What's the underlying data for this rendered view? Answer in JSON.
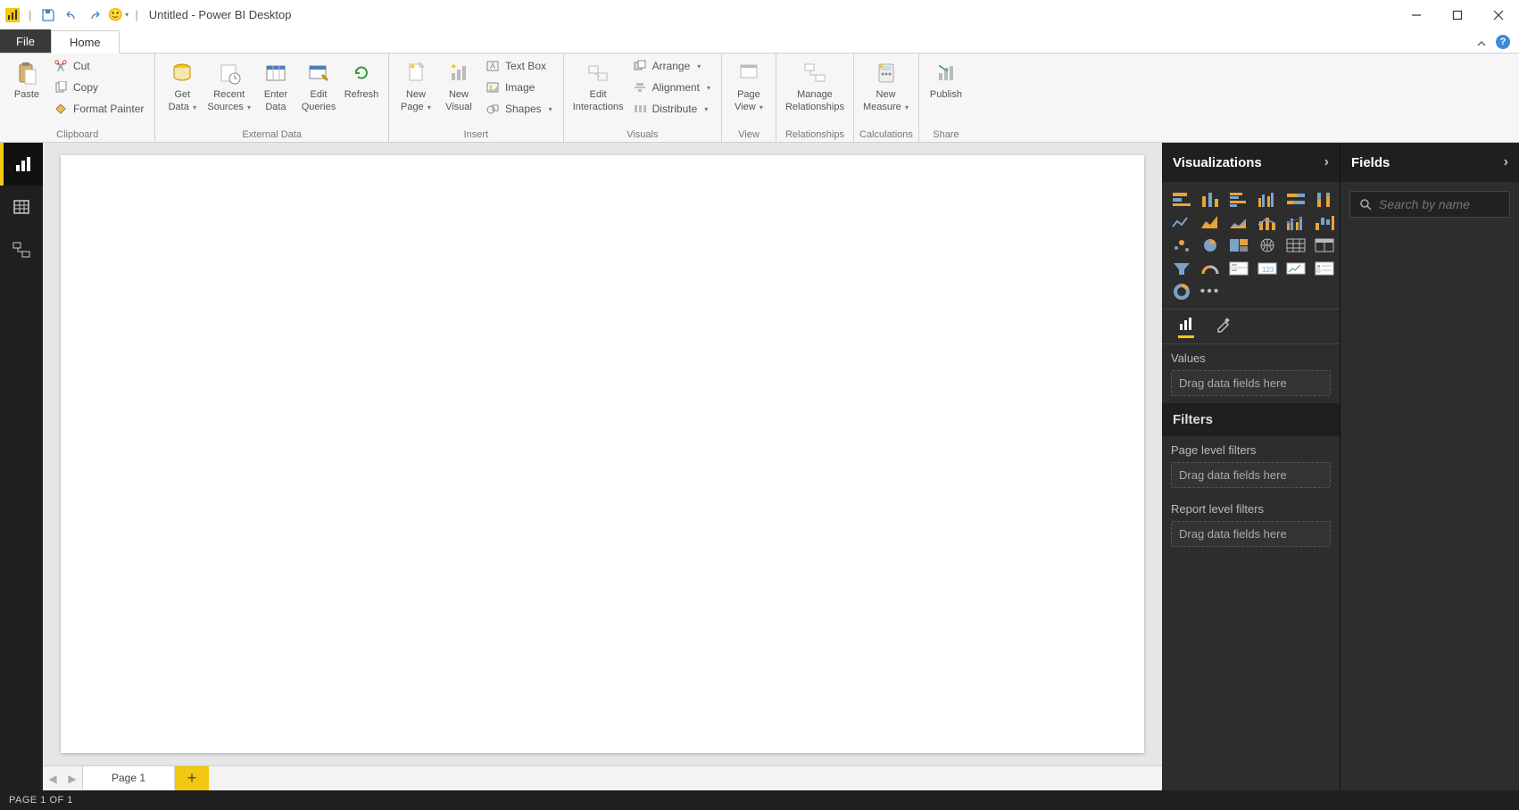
{
  "titlebar": {
    "title": "Untitled - Power BI Desktop"
  },
  "tabs": {
    "file": "File",
    "home": "Home"
  },
  "ribbon": {
    "clipboard": {
      "label": "Clipboard",
      "paste": "Paste",
      "cut": "Cut",
      "copy": "Copy",
      "format_painter": "Format Painter"
    },
    "external_data": {
      "label": "External Data",
      "get_data": "Get\nData",
      "recent_sources": "Recent\nSources",
      "enter_data": "Enter\nData",
      "edit_queries": "Edit\nQueries",
      "refresh": "Refresh"
    },
    "insert": {
      "label": "Insert",
      "new_page": "New\nPage",
      "new_visual": "New\nVisual",
      "text_box": "Text Box",
      "image": "Image",
      "shapes": "Shapes"
    },
    "visuals": {
      "label": "Visuals",
      "edit_interactions": "Edit\nInteractions",
      "arrange": "Arrange",
      "alignment": "Alignment",
      "distribute": "Distribute"
    },
    "view": {
      "label": "View",
      "page_view": "Page\nView"
    },
    "relationships": {
      "label": "Relationships",
      "manage": "Manage\nRelationships"
    },
    "calculations": {
      "label": "Calculations",
      "new_measure": "New\nMeasure"
    },
    "share": {
      "label": "Share",
      "publish": "Publish"
    }
  },
  "pages": {
    "page1": "Page 1"
  },
  "viz": {
    "header": "Visualizations",
    "values_label": "Values",
    "drop_hint": "Drag data fields here"
  },
  "filters": {
    "header": "Filters",
    "page_level": "Page level filters",
    "report_level": "Report level filters",
    "drop_hint": "Drag data fields here"
  },
  "fields": {
    "header": "Fields",
    "search_placeholder": "Search by name"
  },
  "status": "PAGE 1 OF 1"
}
